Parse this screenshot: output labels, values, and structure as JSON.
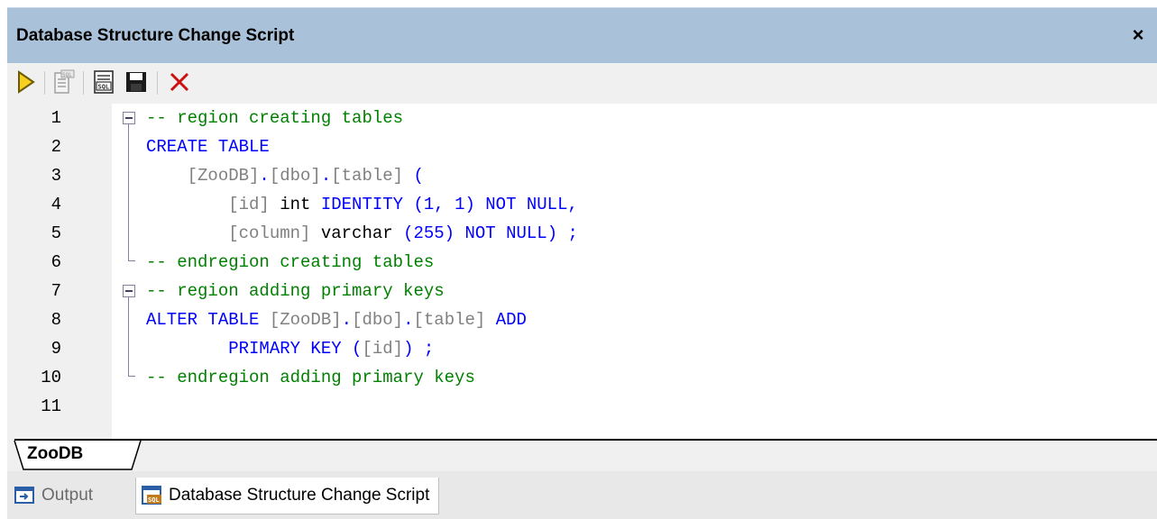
{
  "window": {
    "title": "Database Structure Change Script",
    "close_glyph": "×"
  },
  "toolbar": {
    "buttons": [
      {
        "name": "execute-script-button",
        "icon": "play-icon"
      },
      {
        "name": "open-in-sql-editor-button",
        "icon": "sql-document-icon"
      },
      {
        "name": "show-sql-button",
        "icon": "sql-file-icon"
      },
      {
        "name": "save-button",
        "icon": "floppy-disk-icon"
      },
      {
        "name": "delete-button",
        "icon": "red-x-icon"
      }
    ]
  },
  "editor": {
    "line_numbers": [
      "1",
      "2",
      "3",
      "4",
      "5",
      "6",
      "7",
      "8",
      "9",
      "10",
      "11"
    ],
    "lines": [
      [
        {
          "t": "-- region creating tables",
          "c": "c"
        }
      ],
      [
        {
          "t": "CREATE TABLE",
          "c": "k"
        }
      ],
      [
        {
          "t": "    [ZooDB]",
          "c": "i"
        },
        {
          "t": ".",
          "c": "k"
        },
        {
          "t": "[dbo]",
          "c": "i"
        },
        {
          "t": ".",
          "c": "k"
        },
        {
          "t": "[table]",
          "c": "i"
        },
        {
          "t": " (",
          "c": "k"
        }
      ],
      [
        {
          "t": "        [id]",
          "c": "i"
        },
        {
          "t": " int ",
          "c": "t"
        },
        {
          "t": "IDENTITY (1, 1) NOT NULL,",
          "c": "k"
        }
      ],
      [
        {
          "t": "        [column]",
          "c": "i"
        },
        {
          "t": " varchar ",
          "c": "t"
        },
        {
          "t": "(255) NOT NULL) ;",
          "c": "k"
        }
      ],
      [
        {
          "t": "-- endregion creating tables",
          "c": "c"
        }
      ],
      [
        {
          "t": "-- region adding primary keys",
          "c": "c"
        }
      ],
      [
        {
          "t": "ALTER TABLE ",
          "c": "k"
        },
        {
          "t": "[ZooDB]",
          "c": "i"
        },
        {
          "t": ".",
          "c": "k"
        },
        {
          "t": "[dbo]",
          "c": "i"
        },
        {
          "t": ".",
          "c": "k"
        },
        {
          "t": "[table]",
          "c": "i"
        },
        {
          "t": " ADD",
          "c": "k"
        }
      ],
      [
        {
          "t": "        PRIMARY KEY (",
          "c": "k"
        },
        {
          "t": "[id]",
          "c": "i"
        },
        {
          "t": ") ;",
          "c": "k"
        }
      ],
      [
        {
          "t": "-- endregion adding primary keys",
          "c": "c"
        }
      ],
      []
    ]
  },
  "db_tab": {
    "label": "ZooDB"
  },
  "doc_tabs": [
    {
      "label": "Output",
      "icon": "output-icon",
      "active": false
    },
    {
      "label": "Database Structure Change Script",
      "icon": "sql-script-icon",
      "active": true
    }
  ],
  "colors": {
    "keyword": "#0000ff",
    "comment": "#008000",
    "identifier": "#808080",
    "titlebar": "#a9c1d9"
  }
}
